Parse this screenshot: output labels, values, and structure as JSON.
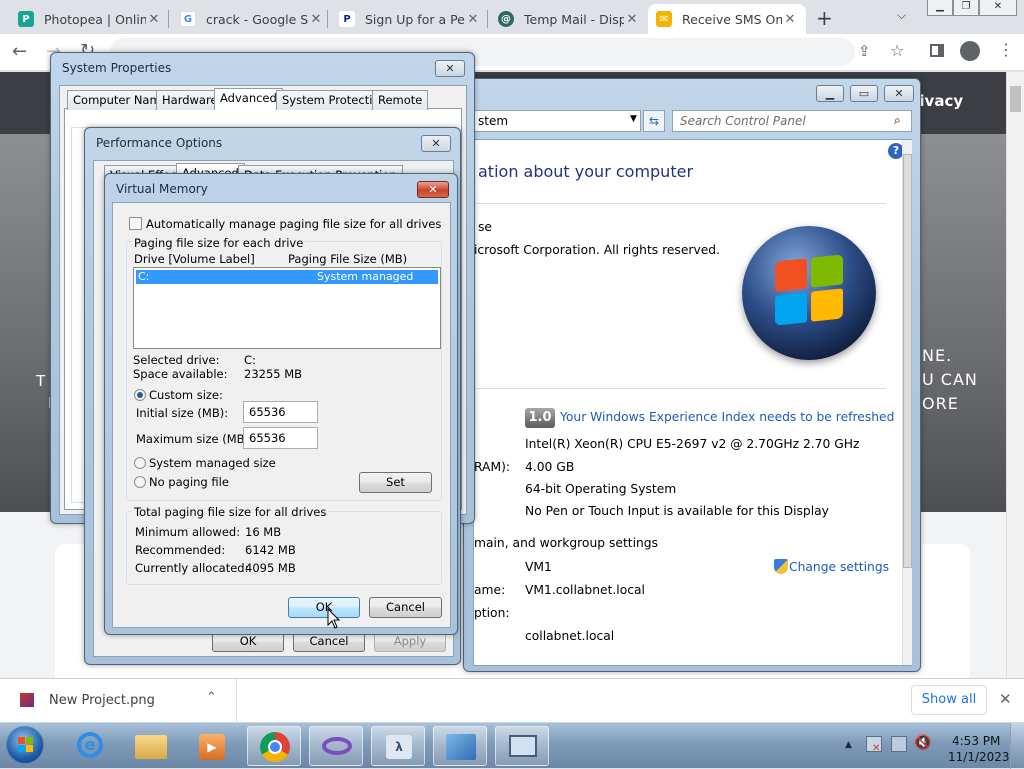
{
  "browser": {
    "tabs": [
      {
        "title": "Photopea | Online",
        "color": "#18a497",
        "glyph": "P"
      },
      {
        "title": "crack - Google Se",
        "color": "#4285f4",
        "glyph": "G"
      },
      {
        "title": "Sign Up for a Pers",
        "color": "#003087",
        "glyph": "P"
      },
      {
        "title": "Temp Mail - Dispo",
        "color": "#2c6b5e",
        "glyph": "@"
      },
      {
        "title": "Receive SMS Onlin",
        "color": "#f4b400",
        "glyph": "✉"
      }
    ],
    "omnibox_text": ""
  },
  "webpage": {
    "header_word": "rivacy",
    "left_letters": [
      "T",
      "I"
    ],
    "right_text": [
      "NE.",
      "U CAN",
      "ORE"
    ]
  },
  "system_properties": {
    "title": "System Properties",
    "tabs": [
      "Computer Name",
      "Hardware",
      "Advanced",
      "System Protection",
      "Remote"
    ],
    "selected_tab": "Advanced"
  },
  "performance_options": {
    "title": "Performance Options",
    "tabs": [
      "Visual Effects",
      "Advanced",
      "Data Execution Prevention"
    ],
    "buttons": {
      "ok": "OK",
      "cancel": "Cancel",
      "apply": "Apply"
    }
  },
  "virtual_memory": {
    "title": "Virtual Memory",
    "auto_manage_label": "Automatically manage paging file size for all drives",
    "auto_manage_checked": false,
    "group_label": "Paging file size for each drive",
    "col_drive": "Drive  [Volume Label]",
    "col_size": "Paging File Size (MB)",
    "drives": [
      {
        "drive": "C:",
        "size": "System managed"
      }
    ],
    "selected_drive_label": "Selected drive:",
    "selected_drive": "C:",
    "space_label": "Space available:",
    "space": "23255 MB",
    "custom_size_label": "Custom size:",
    "initial_label": "Initial size (MB):",
    "initial_value": "65536",
    "max_label": "Maximum size (MB):",
    "max_value": "65536",
    "system_managed_label": "System managed size",
    "no_paging_label": "No paging file",
    "set_label": "Set",
    "total_group_label": "Total paging file size for all drives",
    "min_label": "Minimum allowed:",
    "min_value": "16 MB",
    "rec_label": "Recommended:",
    "rec_value": "6142 MB",
    "alloc_label": "Currently allocated:",
    "alloc_value": "4095 MB",
    "ok_label": "OK",
    "cancel_label": "Cancel"
  },
  "control_panel": {
    "address": "stem",
    "search_placeholder": "Search Control Panel",
    "heading": "ation about your computer",
    "edition_frag": "se",
    "copyright_frag": "icrosoft Corporation.  All rights reserved.",
    "wei_score": "1.0",
    "wei_link": "Your Windows Experience Index needs to be refreshed",
    "processor": "Intel(R) Xeon(R) CPU E5-2697 v2 @ 2.70GHz  2.70 GHz",
    "ram_label_frag": "RAM):",
    "ram": "4.00 GB",
    "system_type": "64-bit Operating System",
    "pen_touch": "No Pen or Touch Input is available for this Display",
    "domain_section_frag": "main, and workgroup settings",
    "change_settings": "Change settings",
    "name_label_frag": "ame:",
    "computer_name": "VM1",
    "fullname_label_frag": "ame:",
    "full_name": "VM1.collabnet.local",
    "desc_label_frag": "ption:",
    "domain": "collabnet.local"
  },
  "downloads": {
    "file": "New Project.png",
    "show_all": "Show all"
  },
  "taskbar": {
    "time": "4:53 PM",
    "date": "11/1/2023"
  }
}
